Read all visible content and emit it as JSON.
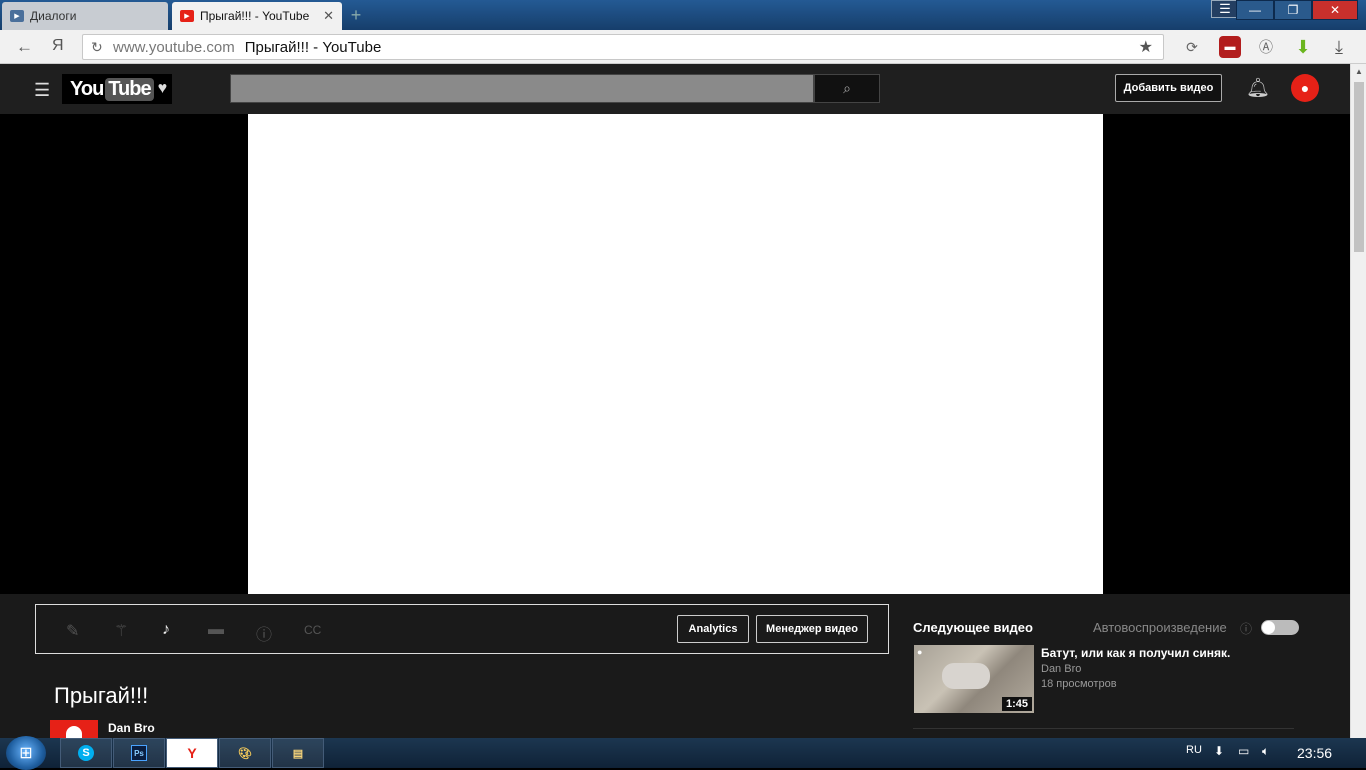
{
  "browser": {
    "tabs": [
      {
        "label": "Диалоги"
      },
      {
        "label": "Прыгай!!! - YouTube"
      }
    ],
    "address": {
      "host": "www.youtube.com",
      "title": "Прыгай!!! - YouTube"
    },
    "yandex_glyph": "Я"
  },
  "youtube": {
    "logo": {
      "you": "You",
      "tube": "Tube"
    },
    "search_placeholder": "",
    "upload_label": "Добавить видео"
  },
  "video": {
    "title": "Прыгай!!!",
    "channel": "Dan Bro",
    "toolbar": {
      "analytics_label": "Analytics",
      "manager_label": "Менеджер видео"
    }
  },
  "sidebar": {
    "next_heading": "Следующее видео",
    "autoplay_label": "Автовоспроизведение",
    "autoplay_on": false,
    "next_video": {
      "title": "Батут, или как я получил синяк.",
      "channel": "Dan Bro",
      "views": "18 просмотров",
      "duration": "1:45"
    }
  },
  "taskbar": {
    "lang": "RU",
    "clock": "23:56",
    "apps": [
      "skype-icon",
      "photoshop-icon",
      "yandex-browser-icon",
      "paint-icon",
      "explorer-icon"
    ],
    "ps_label": "Ps"
  },
  "colors": {
    "yt_red": "#e62117",
    "header": "#1f1f1f",
    "body": "#1a1a1a"
  }
}
